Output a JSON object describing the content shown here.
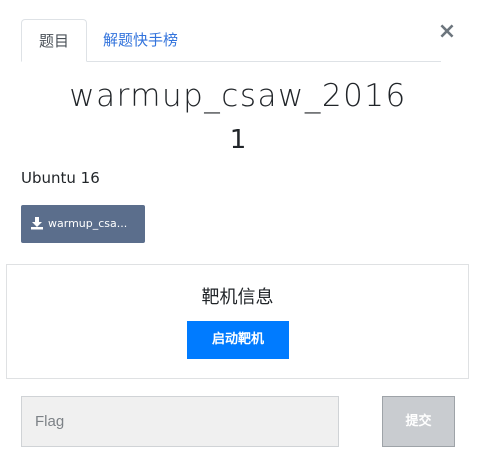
{
  "tabs": {
    "challenge": "题目",
    "solves": "解题快手榜"
  },
  "close_label": "×",
  "challenge": {
    "name": "warmup_csaw_2016",
    "value": "1",
    "description": "Ubuntu 16",
    "file_label": "warmup_csa..."
  },
  "target": {
    "title": "靶机信息",
    "start_label": "启动靶机"
  },
  "submission": {
    "placeholder": "Flag",
    "submit_label": "提交"
  },
  "colors": {
    "file_button": "#5b6e8c",
    "start_button": "#007bff",
    "tab_link": "#3273dc",
    "submit_disabled": "#c9ccd0"
  },
  "icons": {
    "close": "close-icon",
    "download": "download-icon"
  }
}
